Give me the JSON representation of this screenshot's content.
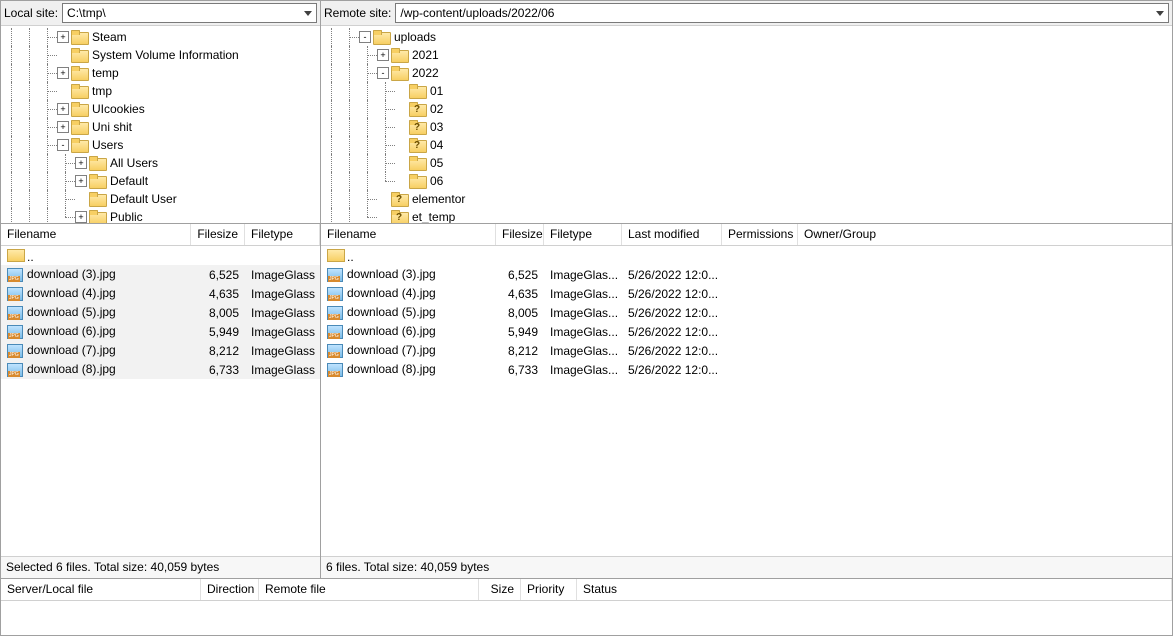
{
  "local": {
    "path_label": "Local site:",
    "path_value": "C:\\tmp\\",
    "tree": [
      {
        "depth": 3,
        "exp": "+",
        "icon": "folder",
        "label": "Steam"
      },
      {
        "depth": 3,
        "exp": "",
        "icon": "folder",
        "label": "System Volume Information"
      },
      {
        "depth": 3,
        "exp": "+",
        "icon": "folder",
        "label": "temp"
      },
      {
        "depth": 3,
        "exp": "",
        "icon": "folder",
        "label": "tmp"
      },
      {
        "depth": 3,
        "exp": "+",
        "icon": "folder",
        "label": "UIcookies"
      },
      {
        "depth": 3,
        "exp": "+",
        "icon": "folder",
        "label": "Uni shit"
      },
      {
        "depth": 3,
        "exp": "-",
        "icon": "folder",
        "label": "Users"
      },
      {
        "depth": 4,
        "exp": "+",
        "icon": "folder",
        "label": "All Users"
      },
      {
        "depth": 4,
        "exp": "+",
        "icon": "folder",
        "label": "Default"
      },
      {
        "depth": 4,
        "exp": "",
        "icon": "folder",
        "label": "Default User"
      },
      {
        "depth": 4,
        "exp": "+",
        "icon": "folder",
        "label": "Public",
        "last": true
      }
    ],
    "columns": {
      "name": "Filename",
      "size": "Filesize",
      "type": "Filetype"
    },
    "up": "..",
    "files": [
      {
        "name": "download (3).jpg",
        "size": "6,525",
        "type": "ImageGlass"
      },
      {
        "name": "download (4).jpg",
        "size": "4,635",
        "type": "ImageGlass"
      },
      {
        "name": "download (5).jpg",
        "size": "8,005",
        "type": "ImageGlass"
      },
      {
        "name": "download (6).jpg",
        "size": "5,949",
        "type": "ImageGlass"
      },
      {
        "name": "download (7).jpg",
        "size": "8,212",
        "type": "ImageGlass"
      },
      {
        "name": "download (8).jpg",
        "size": "6,733",
        "type": "ImageGlass"
      }
    ],
    "status": "Selected 6 files. Total size: 40,059 bytes"
  },
  "remote": {
    "path_label": "Remote site:",
    "path_value": "/wp-content/uploads/2022/06",
    "tree": [
      {
        "depth": 2,
        "exp": "-",
        "icon": "folder",
        "label": "uploads"
      },
      {
        "depth": 3,
        "exp": "+",
        "icon": "folder",
        "label": "2021"
      },
      {
        "depth": 3,
        "exp": "-",
        "icon": "folder",
        "label": "2022"
      },
      {
        "depth": 4,
        "exp": "",
        "icon": "folder",
        "label": "01"
      },
      {
        "depth": 4,
        "exp": "",
        "icon": "folder-q",
        "label": "02"
      },
      {
        "depth": 4,
        "exp": "",
        "icon": "folder-q",
        "label": "03"
      },
      {
        "depth": 4,
        "exp": "",
        "icon": "folder-q",
        "label": "04"
      },
      {
        "depth": 4,
        "exp": "",
        "icon": "folder",
        "label": "05"
      },
      {
        "depth": 4,
        "exp": "",
        "icon": "folder",
        "label": "06",
        "last": true
      },
      {
        "depth": 3,
        "exp": "",
        "icon": "folder-q",
        "label": "elementor"
      },
      {
        "depth": 3,
        "exp": "",
        "icon": "folder-q",
        "label": "et_temp",
        "last": true
      }
    ],
    "columns": {
      "name": "Filename",
      "size": "Filesize",
      "type": "Filetype",
      "mod": "Last modified",
      "perm": "Permissions",
      "owner": "Owner/Group"
    },
    "up": "..",
    "files": [
      {
        "name": "download (3).jpg",
        "size": "6,525",
        "type": "ImageGlas...",
        "mod": "5/26/2022 12:0..."
      },
      {
        "name": "download (4).jpg",
        "size": "4,635",
        "type": "ImageGlas...",
        "mod": "5/26/2022 12:0..."
      },
      {
        "name": "download (5).jpg",
        "size": "8,005",
        "type": "ImageGlas...",
        "mod": "5/26/2022 12:0..."
      },
      {
        "name": "download (6).jpg",
        "size": "5,949",
        "type": "ImageGlas...",
        "mod": "5/26/2022 12:0..."
      },
      {
        "name": "download (7).jpg",
        "size": "8,212",
        "type": "ImageGlas...",
        "mod": "5/26/2022 12:0..."
      },
      {
        "name": "download (8).jpg",
        "size": "6,733",
        "type": "ImageGlas...",
        "mod": "5/26/2022 12:0..."
      }
    ],
    "status": "6 files. Total size: 40,059 bytes"
  },
  "queue": {
    "columns": {
      "slf": "Server/Local file",
      "dir": "Direction",
      "rf": "Remote file",
      "size": "Size",
      "pri": "Priority",
      "stat": "Status"
    }
  }
}
